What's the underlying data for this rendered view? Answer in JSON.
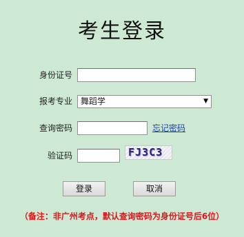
{
  "title": "考生登录",
  "form": {
    "id_label": "身份证号",
    "id_value": "",
    "major_label": "报考专业",
    "major_selected": "舞蹈学",
    "password_label": "查询密码",
    "password_value": "",
    "forgot_link": "忘记密码",
    "captcha_label": "验证码",
    "captcha_value": "",
    "captcha_image_text": "FJ3C3"
  },
  "buttons": {
    "login": "登录",
    "cancel": "取消"
  },
  "note": "（备注：非广州考点，默认查询密码为身份证号后6位）",
  "colors": {
    "background": "#cde9d4",
    "note_red": "#e1141a",
    "link_blue": "#1a3fb0"
  }
}
